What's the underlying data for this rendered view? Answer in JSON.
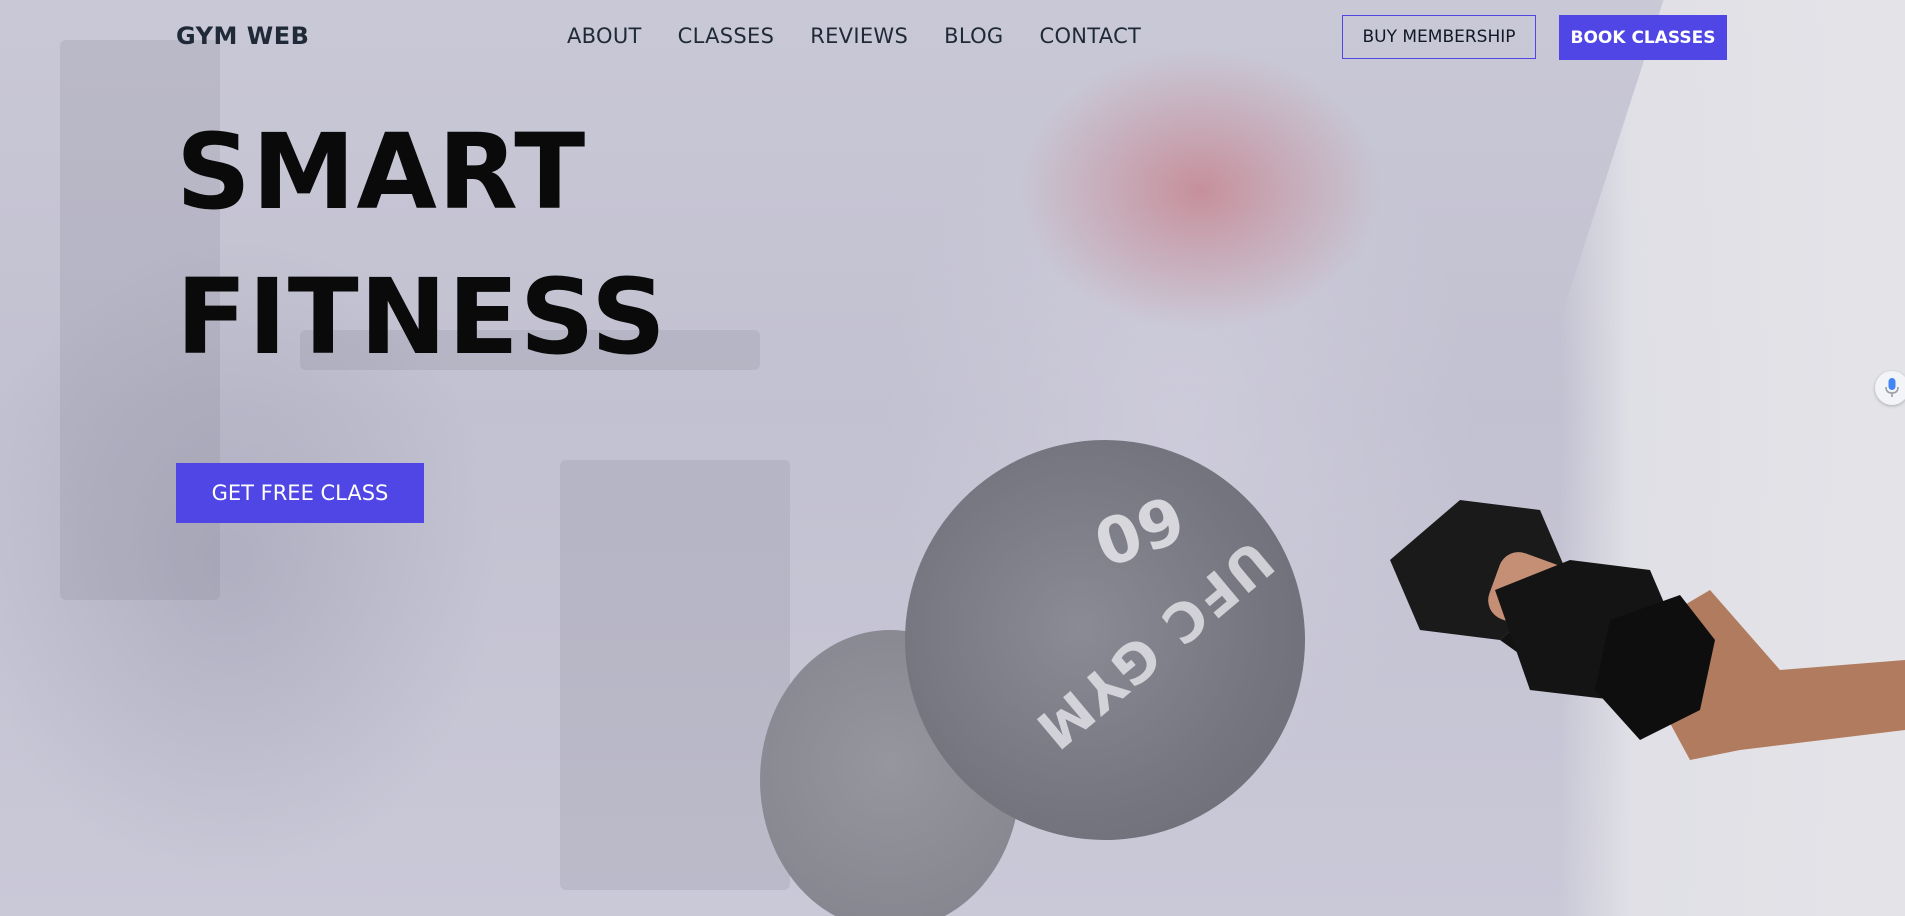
{
  "header": {
    "logo": "GYM WEB",
    "nav": [
      "ABOUT",
      "CLASSES",
      "REVIEWS",
      "BLOG",
      "CONTACT"
    ],
    "buy_membership_label": "BUY MEMBERSHIP",
    "book_classes_label": "BOOK CLASSES"
  },
  "hero": {
    "title_line1": "SMART",
    "title_line2": "FITNESS",
    "cta_label": "GET FREE CLASS"
  },
  "background": {
    "plate_number": "60",
    "plate_brand": "UFC GYM"
  },
  "icons": {
    "mic": "microphone-icon"
  },
  "colors": {
    "accent": "#4f46e5",
    "text_dark": "#1f2937",
    "title": "#0a0a0a"
  }
}
